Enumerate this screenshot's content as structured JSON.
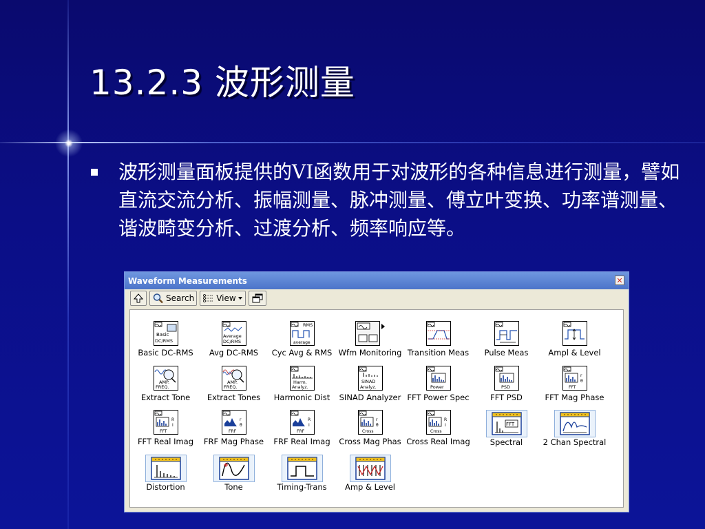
{
  "slide": {
    "title": "13.2.3 波形测量",
    "bullet": "波形测量面板提供的VI函数用于对波形的各种信息进行测量，譬如直流交流分析、振幅测量、脉冲测量、傅立叶变换、功率谱测量、谐波畸变分析、过渡分析、频率响应等。"
  },
  "window": {
    "title": "Waveform Measurements",
    "toolbar": {
      "search_label": "Search",
      "view_label": "View"
    }
  },
  "palette": {
    "items": [
      {
        "label": "Basic DC-RMS",
        "icon_text1": "Basic",
        "icon_text2": "DC/RMS"
      },
      {
        "label": "Avg DC-RMS",
        "icon_text1": "Average",
        "icon_text2": "DC/RMS"
      },
      {
        "label": "Cyc Avg & RMS",
        "icon_text1": "RMS",
        "icon_text2": "average"
      },
      {
        "label": "Wfm Monitoring"
      },
      {
        "label": "Transition Meas"
      },
      {
        "label": "Pulse Meas"
      },
      {
        "label": "Ampl & Level"
      },
      {
        "label": "Extract Tone",
        "icon_text1": "AMP.",
        "icon_text2": "FREQ."
      },
      {
        "label": "Extract Tones",
        "icon_text1": "AMP.",
        "icon_text2": "FREQ."
      },
      {
        "label": "Harmonic Dist",
        "icon_text1": "Harm.",
        "icon_text2": "Analyz."
      },
      {
        "label": "SINAD Analyzer",
        "icon_text1": "SINAD",
        "icon_text2": "Analyz."
      },
      {
        "label": "FFT Power Spec",
        "icon_text1": "Power"
      },
      {
        "label": "FFT PSD",
        "icon_text1": "PSD"
      },
      {
        "label": "FFT Mag Phase",
        "icon_text1": "FFT"
      },
      {
        "label": "FFT Real Imag",
        "icon_text1": "FFT"
      },
      {
        "label": "FRF Mag Phase",
        "icon_text1": "FRF"
      },
      {
        "label": "FRF Real Imag",
        "icon_text1": "FRF"
      },
      {
        "label": "Cross Mag Phas",
        "icon_text1": "Cross"
      },
      {
        "label": "Cross Real Imag",
        "icon_text1": "Cross"
      },
      {
        "label": "Spectral",
        "icon_text1": "FFT"
      },
      {
        "label": "2 Chan Spectral"
      },
      {
        "label": "Distortion"
      },
      {
        "label": "Tone"
      },
      {
        "label": "Timing-Trans"
      },
      {
        "label": "Amp & Level"
      }
    ]
  }
}
